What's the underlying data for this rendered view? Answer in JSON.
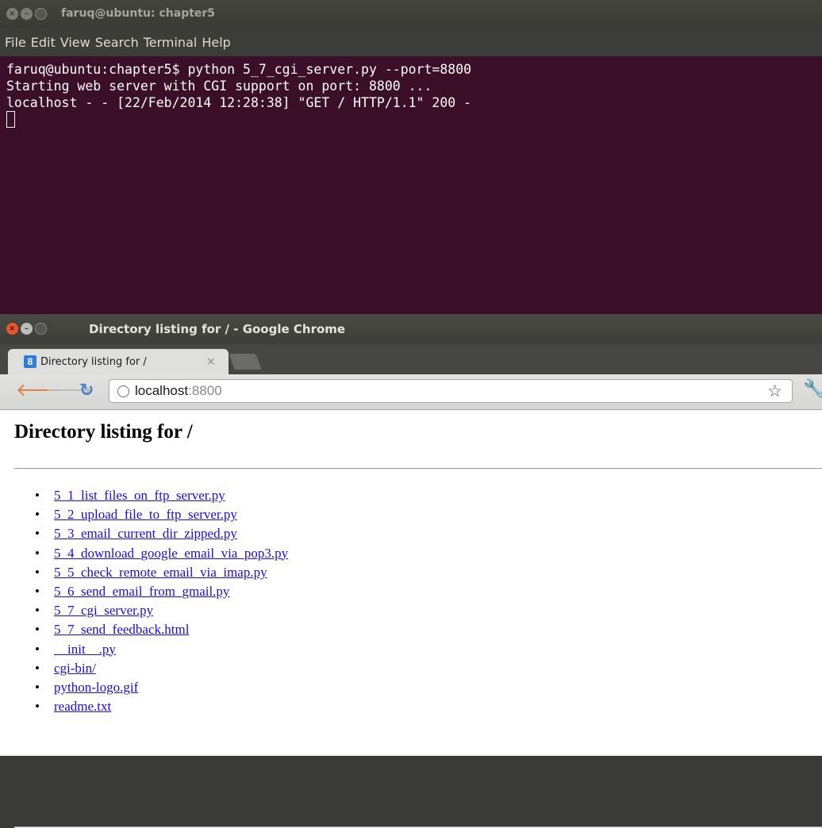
{
  "terminal": {
    "title": "faruq@ubuntu: chapter5",
    "menu": [
      "File",
      "Edit",
      "View",
      "Search",
      "Terminal",
      "Help"
    ],
    "lines": [
      "faruq@ubuntu:chapter5$ python 5_7_cgi_server.py --port=8800",
      "Starting web server with CGI support on port: 8800 ...",
      "localhost - - [22/Feb/2014 12:28:38] \"GET / HTTP/1.1\" 200 -"
    ]
  },
  "chrome": {
    "title": "Directory listing for / - Google Chrome",
    "tab_label": "Directory listing for /",
    "tab_close": "×",
    "favicon_letter": "8",
    "url_host": "localhost",
    "url_port": ":8800"
  },
  "page": {
    "heading": "Directory listing for /",
    "files": [
      "5_1_list_files_on_ftp_server.py",
      "5_2_upload_file_to_ftp_server.py",
      "5_3_email_current_dir_zipped.py",
      "5_4_download_google_email_via_pop3.py",
      "5_5_check_remote_email_via_imap.py",
      "5_6_send_email_from_gmail.py",
      "5_7_cgi_server.py",
      "5_7_send_feedback.html",
      "__init__.py",
      "cgi-bin/",
      "python-logo.gif",
      "readme.txt"
    ]
  },
  "colors": {
    "terminal_bg": "#3c0f28",
    "link": "#1a0dd6",
    "close_button": "#e8562c"
  }
}
